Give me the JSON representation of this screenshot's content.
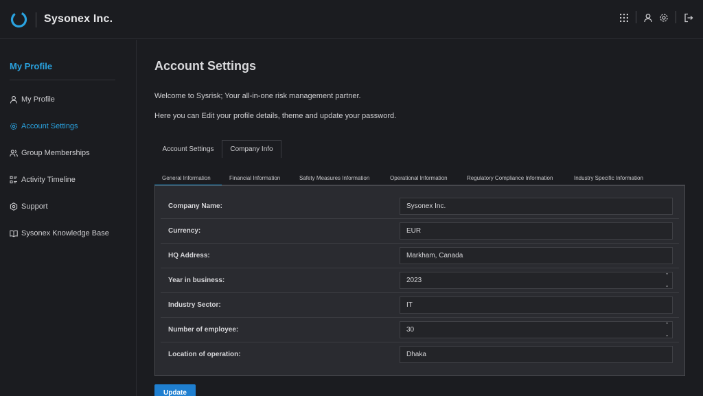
{
  "header": {
    "brand": "Sysonex Inc.",
    "icons": [
      "apps-grid-icon",
      "user-icon",
      "gear-icon",
      "logout-icon"
    ]
  },
  "sidebar": {
    "title": "My Profile",
    "items": [
      {
        "label": "My Profile",
        "icon": "user-icon",
        "active": false
      },
      {
        "label": "Account Settings",
        "icon": "gear-icon",
        "active": true
      },
      {
        "label": "Group Memberships",
        "icon": "users-icon",
        "active": false
      },
      {
        "label": "Activity Timeline",
        "icon": "timeline-icon",
        "active": false
      },
      {
        "label": "Support",
        "icon": "support-icon",
        "active": false
      },
      {
        "label": "Sysonex Knowledge Base",
        "icon": "book-icon",
        "active": false
      }
    ]
  },
  "main": {
    "title": "Account Settings",
    "intro1": "Welcome to Sysrisk; Your all-in-one risk management partner.",
    "intro2": "Here you can Edit your profile details, theme and update your password.",
    "tabs": [
      {
        "label": "Account Settings",
        "active": false
      },
      {
        "label": "Company Info",
        "active": true
      }
    ],
    "subtabs": [
      {
        "label": "General Information",
        "active": true
      },
      {
        "label": "Financial Information",
        "active": false
      },
      {
        "label": "Safety Measures Information",
        "active": false
      },
      {
        "label": "Operational Information",
        "active": false
      },
      {
        "label": "Regulatory Compliance Information",
        "active": false
      },
      {
        "label": "Industry Specific Information",
        "active": false
      }
    ],
    "fields": [
      {
        "label": "Company Name:",
        "value": "Sysonex Inc.",
        "spinner": false
      },
      {
        "label": "Currency:",
        "value": "EUR",
        "spinner": false
      },
      {
        "label": "HQ Address:",
        "value": "Markham, Canada",
        "spinner": false
      },
      {
        "label": "Year in business:",
        "value": "2023",
        "spinner": true
      },
      {
        "label": "Industry Sector:",
        "value": "IT",
        "spinner": false
      },
      {
        "label": "Number of employee:",
        "value": "30",
        "spinner": true
      },
      {
        "label": "Location of operation:",
        "value": "Dhaka",
        "spinner": false
      }
    ],
    "update_label": "Update"
  },
  "colors": {
    "accent": "#2aa3e0",
    "background": "#1b1c20",
    "panel": "#2a2b30",
    "button": "#1f7fd0"
  }
}
